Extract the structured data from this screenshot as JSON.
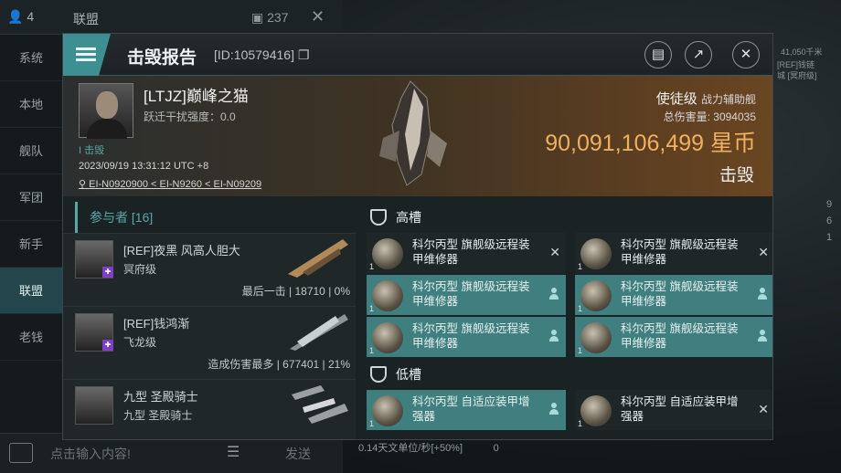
{
  "background": {
    "user_count": "4",
    "chat_title": "联盟",
    "member_count": "237",
    "nav": [
      "系统",
      "本地",
      "舰队",
      "军团",
      "新手",
      "联盟",
      "老钱"
    ],
    "nav_active": 5,
    "input_placeholder": "点击输入内容!",
    "send_label": "发送",
    "speed_text": "0.14天文单位/秒[+50%]",
    "speed_value": "0",
    "right_info": [
      "41,050千米",
      "[REF]钱链",
      "城 [冥府级]"
    ],
    "right_counts": [
      "9",
      "6",
      "1"
    ]
  },
  "header": {
    "title": "击毁报告",
    "report_id": "[ID:10579416]"
  },
  "victim": {
    "name": "[LTJZ]巅峰之猫",
    "jam_label": "跃迁干扰强度：0.0",
    "kill_tag": "I 击毁",
    "datetime": "2023/09/19 13:31:12 UTC +8",
    "location": "EI-N0920900 < EI-N9260 < EI-N09209",
    "ship_class": "使徒级",
    "ship_role": "战力辅助舰",
    "total_damage_label": "总伤害量: 3094035",
    "isk_value": "90,091,106,499",
    "isk_unit": "星币",
    "result": "击毁"
  },
  "participants": {
    "header": "参与者 [16]",
    "rows": [
      {
        "name": "[REF]夜黑 风高人胆大",
        "ship": "冥府级",
        "stat": "最后一击 | 18710 | 0%"
      },
      {
        "name": "[REF]钱鸿渐",
        "ship": "飞龙级",
        "stat": "造成伤害最多 | 677401 | 21%"
      },
      {
        "name": "九型 圣殿骑士",
        "ship": "九型 圣殿骑士",
        "stat": ""
      }
    ]
  },
  "slots": {
    "high_label": "高槽",
    "low_label": "低槽",
    "high": [
      {
        "name": "科尔丙型 旗舰级远程装甲维修器",
        "qty": "1",
        "state": "destroyed"
      },
      {
        "name": "科尔丙型 旗舰级远程装甲维修器",
        "qty": "1",
        "state": "destroyed"
      },
      {
        "name": "科尔丙型 旗舰级远程装甲维修器",
        "qty": "1",
        "state": "dropped"
      },
      {
        "name": "科尔丙型 旗舰级远程装甲维修器",
        "qty": "1",
        "state": "dropped"
      },
      {
        "name": "科尔丙型 旗舰级远程装甲维修器",
        "qty": "1",
        "state": "dropped"
      },
      {
        "name": "科尔丙型 旗舰级远程装甲维修器",
        "qty": "1",
        "state": "dropped"
      }
    ],
    "low": [
      {
        "name": "科尔丙型 自适应装甲增强器",
        "qty": "1",
        "state": "dropped"
      },
      {
        "name": "科尔丙型 自适应装甲增强器",
        "qty": "1",
        "state": "destroyed"
      }
    ]
  },
  "colors": {
    "accent": "#3e8f91",
    "isk": "#f0b060",
    "dropped": "#3f7f80"
  }
}
